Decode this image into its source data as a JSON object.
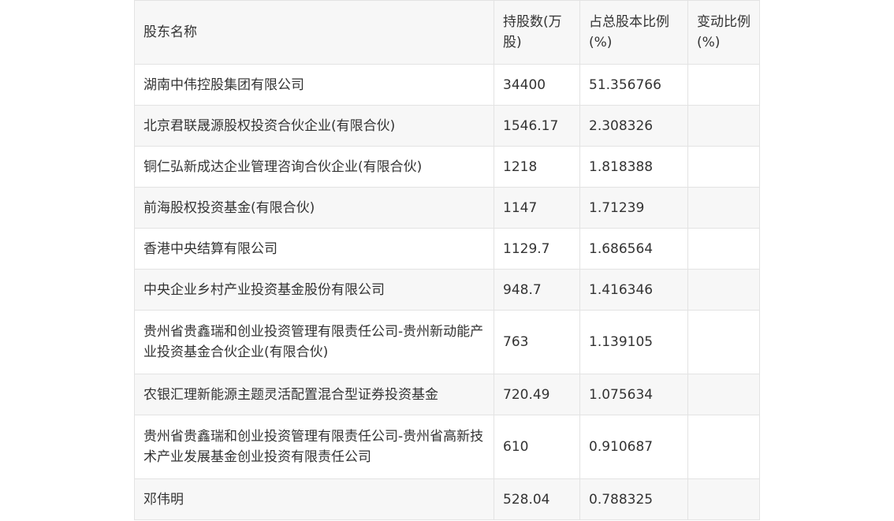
{
  "table": {
    "headers": [
      "股东名称",
      "持股数(万股)",
      "占总股本比例(%)",
      "变动比例(%)"
    ],
    "rows": [
      {
        "name": "湖南中伟控股集团有限公司",
        "shares": "34400",
        "ratio": "51.356766",
        "change": ""
      },
      {
        "name": "北京君联晟源股权投资合伙企业(有限合伙)",
        "shares": "1546.17",
        "ratio": "2.308326",
        "change": ""
      },
      {
        "name": "铜仁弘新成达企业管理咨询合伙企业(有限合伙)",
        "shares": "1218",
        "ratio": "1.818388",
        "change": ""
      },
      {
        "name": "前海股权投资基金(有限合伙)",
        "shares": "1147",
        "ratio": "1.71239",
        "change": ""
      },
      {
        "name": "香港中央结算有限公司",
        "shares": "1129.7",
        "ratio": "1.686564",
        "change": ""
      },
      {
        "name": "中央企业乡村产业投资基金股份有限公司",
        "shares": "948.7",
        "ratio": "1.416346",
        "change": ""
      },
      {
        "name": "贵州省贵鑫瑞和创业投资管理有限责任公司-贵州新动能产业投资基金合伙企业(有限合伙)",
        "shares": "763",
        "ratio": "1.139105",
        "change": ""
      },
      {
        "name": "农银汇理新能源主题灵活配置混合型证券投资基金",
        "shares": "720.49",
        "ratio": "1.075634",
        "change": ""
      },
      {
        "name": "贵州省贵鑫瑞和创业投资管理有限责任公司-贵州省高新技术产业发展基金创业投资有限责任公司",
        "shares": "610",
        "ratio": "0.910687",
        "change": ""
      },
      {
        "name": "邓伟明",
        "shares": "528.04",
        "ratio": "0.788325",
        "change": ""
      }
    ]
  }
}
